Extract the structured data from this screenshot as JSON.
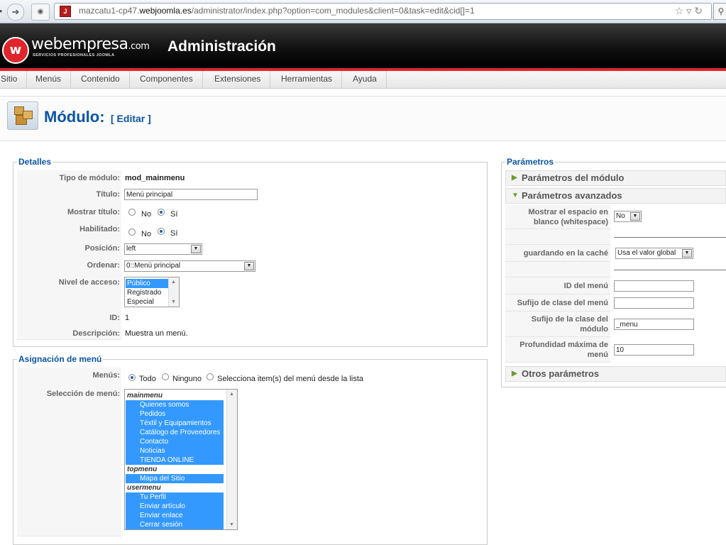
{
  "browser": {
    "url_prefix": "mazcatu1-cp47.",
    "url_domain": "webjoomla.es",
    "url_path": "/administrator/index.php?option=com_modules&client=0&task=edit&cid[]=1"
  },
  "header": {
    "logo_text": "webempresa",
    "logo_suffix": ".com",
    "logo_tagline": "SERVICIOS PROFESIONALES JOOMLA",
    "title": "Administración"
  },
  "menu": [
    "Sitio",
    "Menús",
    "Contenido",
    "Componentes",
    "Extensiones",
    "Herramientas",
    "Ayuda"
  ],
  "page": {
    "title": "Módulo:",
    "subtitle": "[ Editar ]"
  },
  "details": {
    "legend": "Detalles",
    "tipo_label": "Tipo de módulo:",
    "tipo_value": "mod_mainmenu",
    "titulo_label": "Título:",
    "titulo_value": "Menú principal",
    "mostrar_titulo_label": "Mostrar título:",
    "habilitado_label": "Habilitado:",
    "no": "No",
    "si": "Sí",
    "posicion_label": "Posición:",
    "posicion_value": "left",
    "ordenar_label": "Ordenar:",
    "ordenar_value": "0::Menú principal",
    "nivel_label": "Nivel de acceso:",
    "nivel_options": [
      "Público",
      "Registrado",
      "Especial"
    ],
    "id_label": "ID:",
    "id_value": "1",
    "desc_label": "Descripción:",
    "desc_value": "Muestra un menú."
  },
  "assignment": {
    "legend": "Asignación de menú",
    "menus_label": "Menús:",
    "opt_todo": "Todo",
    "opt_ninguno": "Ninguno",
    "opt_selecciona": "Selecciona item(s) del menú desde la lista",
    "seleccion_label": "Selección de menú:",
    "groups": [
      {
        "name": "mainmenu",
        "items": [
          "Quienes somos",
          "Pedidos",
          "Téxtil y Equipamientos",
          "Catálogo de Proveedores",
          "Contacto",
          "Noticias",
          "TIENDA ONLINE"
        ]
      },
      {
        "name": "topmenu",
        "items": [
          "Mapa del Sitio"
        ]
      },
      {
        "name": "usermenu",
        "items": [
          "Tu Perfil",
          "Enviar artículo",
          "Enviar enlace",
          "Cerrar sesión"
        ]
      }
    ]
  },
  "params": {
    "legend": "Parámetros",
    "modulo_head": "Parámetros del módulo",
    "avanzados_head": "Parámetros avanzados",
    "otros_head": "Otros parámetros",
    "whitespace_label": "Mostrar el espacio en blanco (whitespace)",
    "whitespace_value": "No",
    "cache_label": "guardando en la caché",
    "cache_value": "Usa el valor global",
    "id_menu_label": "ID del menú",
    "id_menu_value": "",
    "sufijo_menu_label": "Sufijo de clase del menú",
    "sufijo_menu_value": "",
    "sufijo_modulo_label": "Sufijo de la clase del módulo",
    "sufijo_modulo_value": "_menu",
    "profundidad_label": "Profundidad máxima de menú",
    "profundidad_value": "10"
  }
}
